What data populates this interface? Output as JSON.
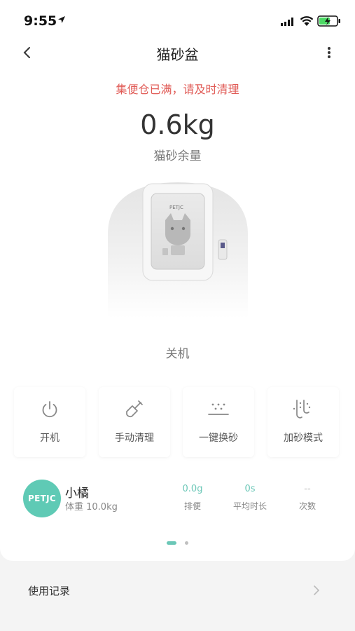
{
  "status_bar": {
    "time": "9:55"
  },
  "header": {
    "title": "猫砂盆"
  },
  "alert": {
    "message": "集便仓已满，请及时清理"
  },
  "litter": {
    "weight": "0.6kg",
    "label": "猫砂余量"
  },
  "device": {
    "status": "关机",
    "brand": "PETJC"
  },
  "actions": [
    {
      "label": "开机",
      "icon": "power-icon"
    },
    {
      "label": "手动清理",
      "icon": "shovel-icon"
    },
    {
      "label": "一键换砂",
      "icon": "sand-change-icon"
    },
    {
      "label": "加砂模式",
      "icon": "add-sand-icon"
    }
  ],
  "pet": {
    "avatar_text": "PETJC",
    "name": "小橘",
    "weight": "体重 10.0kg",
    "stats": [
      {
        "value": "0.0g",
        "label": "排便"
      },
      {
        "value": "0s",
        "label": "平均时长"
      },
      {
        "value": "--",
        "label": "次数"
      }
    ]
  },
  "pagination": {
    "total": 2,
    "active": 0
  },
  "records": {
    "label": "使用记录"
  },
  "colors": {
    "accent": "#6bc7b7",
    "alert": "#e05a55",
    "avatar": "#5fcab5"
  }
}
